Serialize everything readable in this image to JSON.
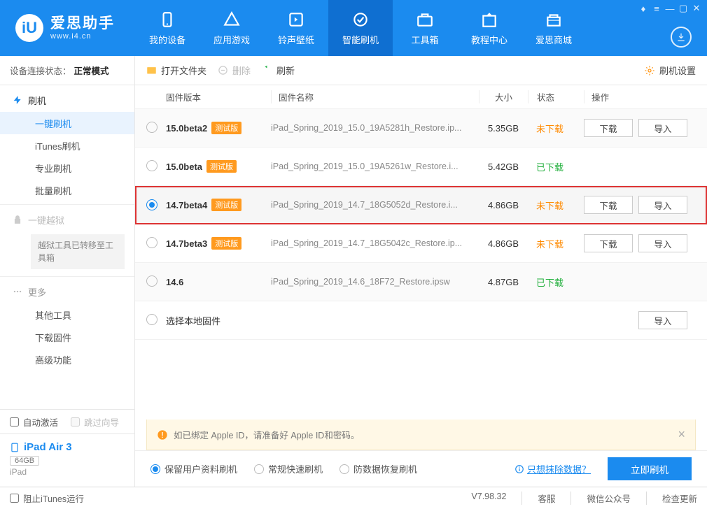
{
  "brand": {
    "cn": "爱思助手",
    "site": "www.i4.cn"
  },
  "nav": [
    {
      "label": "我的设备"
    },
    {
      "label": "应用游戏"
    },
    {
      "label": "铃声壁纸"
    },
    {
      "label": "智能刷机",
      "active": true
    },
    {
      "label": "工具箱"
    },
    {
      "label": "教程中心"
    },
    {
      "label": "爱思商城"
    }
  ],
  "connection_label": "设备连接状态：",
  "connection_value": "正常模式",
  "sidebar": {
    "section1": {
      "title": "刷机",
      "items": [
        "一键刷机",
        "iTunes刷机",
        "专业刷机",
        "批量刷机"
      ]
    },
    "section2": {
      "title": "一键越狱",
      "note": "越狱工具已转移至工具箱"
    },
    "section3": {
      "title": "更多",
      "items": [
        "其他工具",
        "下载固件",
        "高级功能"
      ]
    },
    "auto_activate": "自动激活",
    "skip_guide": "跳过向导",
    "device_name": "iPad Air 3",
    "device_cap": "64GB",
    "device_model": "iPad"
  },
  "toolbar": {
    "open": "打开文件夹",
    "delete": "删除",
    "refresh": "刷新",
    "settings": "刷机设置"
  },
  "columns": {
    "version": "固件版本",
    "name": "固件名称",
    "size": "大小",
    "status": "状态",
    "action": "操作"
  },
  "rows": [
    {
      "ver": "15.0beta2",
      "beta": true,
      "name": "iPad_Spring_2019_15.0_19A5281h_Restore.ip...",
      "size": "5.35GB",
      "status": "not",
      "sel": false,
      "dl": true,
      "imp": true,
      "alt": true
    },
    {
      "ver": "15.0beta",
      "beta": true,
      "name": "iPad_Spring_2019_15.0_19A5261w_Restore.i...",
      "size": "5.42GB",
      "status": "done",
      "sel": false,
      "dl": false,
      "imp": false,
      "alt": false
    },
    {
      "ver": "14.7beta4",
      "beta": true,
      "name": "iPad_Spring_2019_14.7_18G5052d_Restore.i...",
      "size": "4.86GB",
      "status": "not",
      "sel": true,
      "dl": true,
      "imp": true,
      "alt": true
    },
    {
      "ver": "14.7beta3",
      "beta": true,
      "name": "iPad_Spring_2019_14.7_18G5042c_Restore.ip...",
      "size": "4.86GB",
      "status": "not",
      "sel": false,
      "dl": true,
      "imp": true,
      "alt": false
    },
    {
      "ver": "14.6",
      "beta": false,
      "name": "iPad_Spring_2019_14.6_18F72_Restore.ipsw",
      "size": "4.87GB",
      "status": "done",
      "sel": false,
      "dl": false,
      "imp": false,
      "alt": true
    }
  ],
  "local_row": "选择本地固件",
  "status_text": {
    "not": "未下载",
    "done": "已下载"
  },
  "action_btn": {
    "download": "下载",
    "import": "导入"
  },
  "beta_label": "测试版",
  "notice": "如已绑定 Apple ID，请准备好 Apple ID和密码。",
  "flash_opts": [
    "保留用户资料刷机",
    "常规快速刷机",
    "防数据恢复刷机"
  ],
  "erase_link": "只想抹除数据？",
  "flash_btn": "立即刷机",
  "footer": {
    "itunes": "阻止iTunes运行",
    "ver": "V7.98.32",
    "kefu": "客服",
    "wx": "微信公众号",
    "upd": "检查更新"
  }
}
